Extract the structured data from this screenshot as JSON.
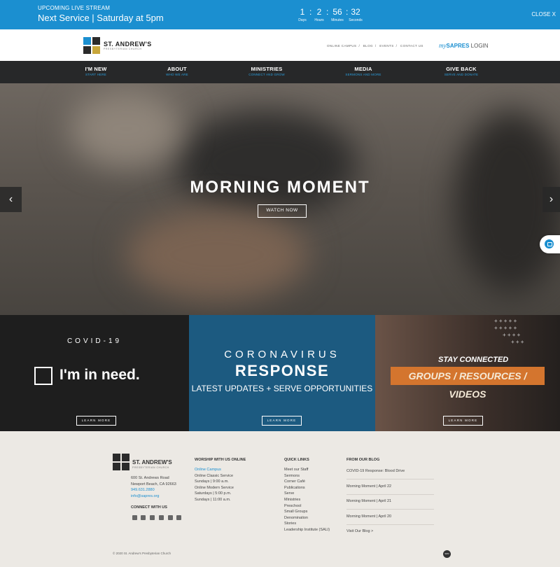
{
  "livestream": {
    "label": "UPCOMING LIVE STREAM",
    "next_service": "Next Service | Saturday at 5pm",
    "countdown": [
      {
        "value": "1",
        "unit": "Days"
      },
      {
        "value": "2",
        "unit": "Hours"
      },
      {
        "value": "56",
        "unit": "Minutes"
      },
      {
        "value": "32",
        "unit": "Seconds"
      }
    ],
    "separator": ":",
    "close_label": "CLOSE X"
  },
  "header": {
    "logo_name": "ST. ANDREW'S",
    "logo_sub": "PRESBYTERIAN CHURCH",
    "utility_links": [
      "ONLINE CAMPUS",
      "BLOG",
      "EVENTS",
      "CONTACT US"
    ],
    "utility_sep": "/",
    "mysapres_my": "my",
    "mysapres_brand": "SAPRES",
    "mysapres_login": "LOGIN"
  },
  "nav": [
    {
      "title": "I'M NEW",
      "sub": "START HERE"
    },
    {
      "title": "ABOUT",
      "sub": "WHO WE ARE"
    },
    {
      "title": "MINISTRIES",
      "sub": "CONNECT AND GROW"
    },
    {
      "title": "MEDIA",
      "sub": "SERMONS AND MORE"
    },
    {
      "title": "GIVE BACK",
      "sub": "SERVE AND DONATE"
    }
  ],
  "hero": {
    "title": "MORNING MOMENT",
    "button": "WATCH NOW",
    "prev_arrow": "‹",
    "next_arrow": "›"
  },
  "panels": {
    "covid": {
      "heading": "COVID-19",
      "need": "I'm in need.",
      "button": "LEARN MORE"
    },
    "coronavirus": {
      "line1": "CORONAVIRUS",
      "line2": "RESPONSE",
      "line3": "LATEST UPDATES + SERVE OPPORTUNITIES",
      "button": "LEARN MORE"
    },
    "stay": {
      "heading": "STAY CONNECTED",
      "groups": "GROUPS / RESOURCES / VIDEOS",
      "button": "LEARN MORE"
    }
  },
  "footer": {
    "logo_name": "ST. ANDREW'S",
    "logo_sub": "PRESBYTERIAN CHURCH",
    "address1": "600 St. Andrews Road",
    "address2": "Newport Beach, CA  92663",
    "phone": "949.631.2880",
    "email": "info@sapres.org",
    "connect_title": "CONNECT WITH US",
    "social_icons": [
      "facebook-icon",
      "youtube-icon",
      "instagram-icon",
      "yelp-icon",
      "vimeo-icon",
      "twitter-icon"
    ],
    "worship": {
      "title": "WORSHIP WITH US ONLINE",
      "items": [
        "Online Campus",
        "Online Classic Service",
        "Sundays | 9:00 a.m.",
        "Online Modern Service",
        "Saturdays | 5:00 p.m.",
        "Sundays | 11:00 a.m."
      ]
    },
    "quick": {
      "title": "QUICK LINKS",
      "items": [
        "Meet our Staff",
        "Sermons",
        "Corner Café",
        "Publications",
        "Serve",
        "Ministries",
        "Preschool",
        "Small Groups",
        "Denomination",
        "Stories",
        "Leadership Institute (SALI)"
      ]
    },
    "blog": {
      "title": "FROM OUR BLOG",
      "items": [
        "COVID-19 Response: Blood Drive",
        "Morning Moment | April 22",
        "Morning Moment | April 21",
        "Morning Moment | April 20"
      ],
      "visit": "Visit Our Blog >"
    },
    "copyright": "© 2020 St. Andrew's Presbyterian Church",
    "badge": "SPR"
  },
  "colors": {
    "accent": "#1b8fd0",
    "nav_bg": "#272829",
    "covid_bg": "#1e1e1e",
    "response_bg": "#1c5a80",
    "orange": "#d4752e"
  }
}
